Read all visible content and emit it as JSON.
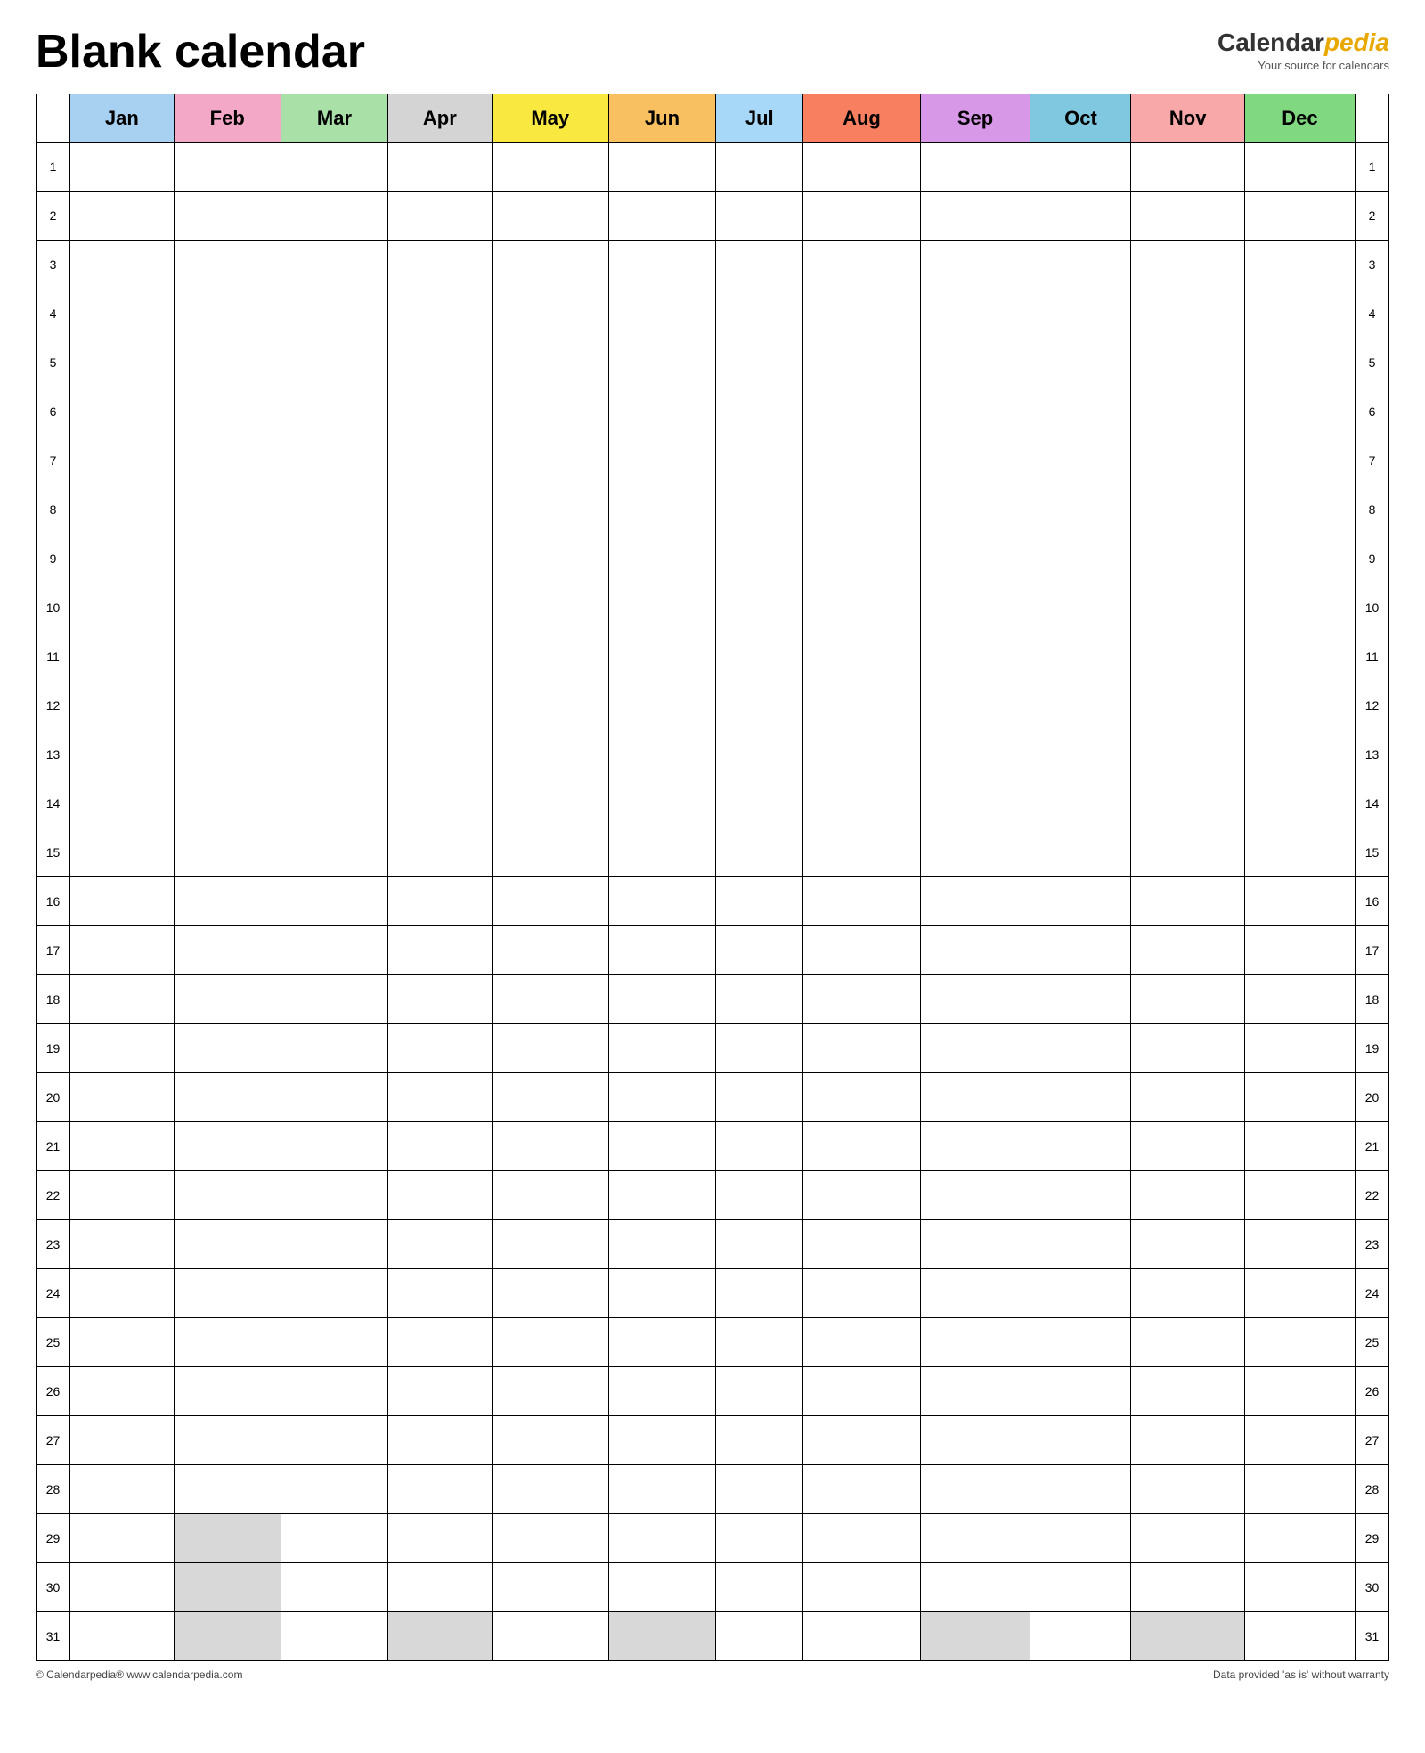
{
  "header": {
    "title": "Blank calendar",
    "brand_name_part1": "Calendar",
    "brand_name_part2": "pedia",
    "brand_tagline": "Your source for calendars"
  },
  "months": [
    {
      "label": "Jan",
      "color_class": "month-jan",
      "max_days": 31
    },
    {
      "label": "Feb",
      "color_class": "month-feb",
      "max_days": 28
    },
    {
      "label": "Mar",
      "color_class": "month-mar",
      "max_days": 31
    },
    {
      "label": "Apr",
      "color_class": "month-apr",
      "max_days": 30
    },
    {
      "label": "May",
      "color_class": "month-may",
      "max_days": 31
    },
    {
      "label": "Jun",
      "color_class": "month-jun",
      "max_days": 30
    },
    {
      "label": "Jul",
      "color_class": "month-jul",
      "max_days": 31
    },
    {
      "label": "Aug",
      "color_class": "month-aug",
      "max_days": 31
    },
    {
      "label": "Sep",
      "color_class": "month-sep",
      "max_days": 30
    },
    {
      "label": "Oct",
      "color_class": "month-oct",
      "max_days": 31
    },
    {
      "label": "Nov",
      "color_class": "month-nov",
      "max_days": 30
    },
    {
      "label": "Dec",
      "color_class": "month-dec",
      "max_days": 31
    }
  ],
  "days": [
    1,
    2,
    3,
    4,
    5,
    6,
    7,
    8,
    9,
    10,
    11,
    12,
    13,
    14,
    15,
    16,
    17,
    18,
    19,
    20,
    21,
    22,
    23,
    24,
    25,
    26,
    27,
    28,
    29,
    30,
    31
  ],
  "footer": {
    "left": "© Calendarpedia®  www.calendarpedia.com",
    "right": "Data provided 'as is' without warranty"
  }
}
